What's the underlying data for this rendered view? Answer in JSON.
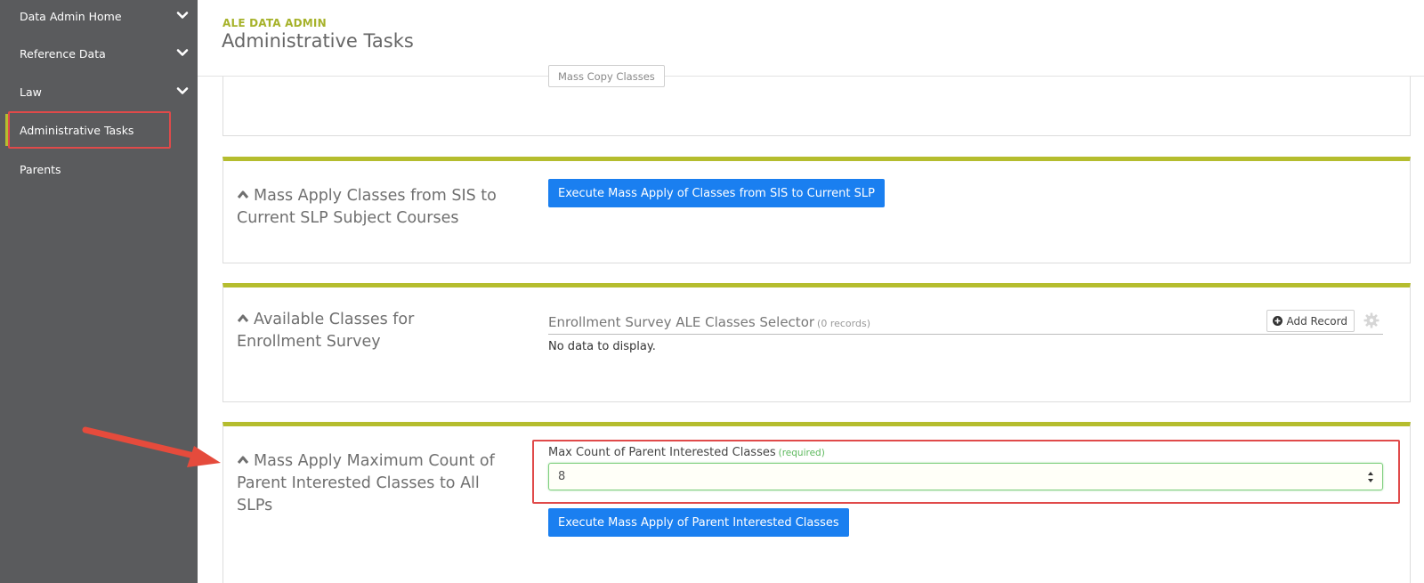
{
  "sidebar": {
    "items": [
      {
        "label": "Data Admin Home",
        "has_chevron": true
      },
      {
        "label": "Reference Data",
        "has_chevron": true
      },
      {
        "label": "Law",
        "has_chevron": true
      },
      {
        "label": "Administrative Tasks",
        "active": true
      },
      {
        "label": "Parents"
      }
    ]
  },
  "header": {
    "app_name": "ALE DATA ADMIN",
    "title": "Administrative Tasks"
  },
  "panels": {
    "mass_copy": {
      "button_label": "Mass Copy Classes"
    },
    "mass_apply_sis": {
      "title": "Mass Apply Classes from SIS to Current SLP Subject Courses",
      "button_label": "Execute Mass Apply of Classes from SIS to Current SLP"
    },
    "enrollment_survey": {
      "title": "Available Classes for Enrollment Survey",
      "grid_title": "Enrollment Survey ALE Classes Selector",
      "record_count": "(0 records)",
      "add_record_label": "Add Record",
      "empty_text": "No data to display."
    },
    "max_count": {
      "title": "Mass Apply Maximum Count of Parent Interested Classes to All SLPs",
      "field_label": "Max Count of Parent Interested Classes",
      "required_text": "(required)",
      "field_value": "8",
      "button_label": "Execute Mass Apply of Parent Interested Classes"
    }
  },
  "colors": {
    "sidebar_bg": "#5a5b5d",
    "accent": "#b5bd2e",
    "primary_button": "#1a7ff0",
    "annotation": "#e04a4a"
  }
}
